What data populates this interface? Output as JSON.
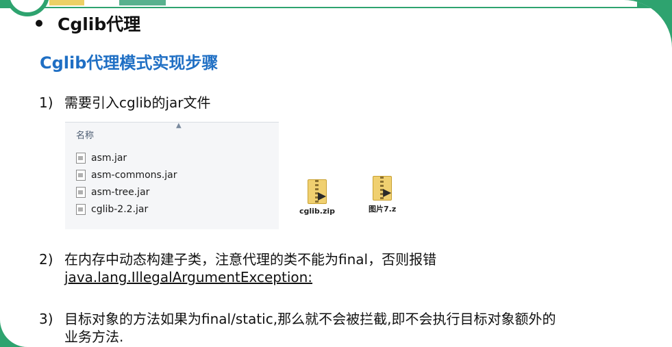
{
  "title": "Cglib代理",
  "subtitle": "Cglib代理模式实现步骤",
  "steps": [
    {
      "num": "1)",
      "text": "需要引入cglib的jar文件"
    },
    {
      "num": "2)",
      "text": "在内存中动态构建子类，注意代理的类不能为final，否则报错",
      "link": "java.lang.IllegalArgumentException:"
    },
    {
      "num": "3)",
      "text": "目标对象的方法如果为final/static,那么就不会被拦截,即不会执行目标对象额外的",
      "text2": "业务方法."
    }
  ],
  "file_browser": {
    "column_header": "名称",
    "files": [
      "asm.jar",
      "asm-commons.jar",
      "asm-tree.jar",
      "cglib-2.2.jar"
    ]
  },
  "archives": [
    {
      "label": "cglib.zip",
      "icon": "zip-folder-icon"
    },
    {
      "label": "图片7.z",
      "icon": "zip-folder-icon"
    }
  ],
  "colors": {
    "accent": "#2ea36f",
    "subtitle": "#1f6fc4"
  }
}
